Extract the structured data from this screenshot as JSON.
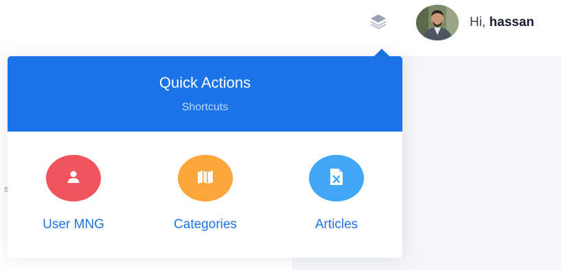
{
  "header": {
    "greeting_prefix": "Hi,",
    "username": "hassan",
    "layers_icon": "layers-icon",
    "avatar_icon": "user-avatar"
  },
  "quick_actions": {
    "title": "Quick Actions",
    "subtitle": "Shortcuts",
    "items": [
      {
        "label": "User MNG",
        "icon": "user-icon",
        "color": "#f0545d"
      },
      {
        "label": "Categories",
        "icon": "map-icon",
        "color": "#fba53b"
      },
      {
        "label": "Articles",
        "icon": "excel-file-icon",
        "color": "#40a6f5"
      }
    ]
  },
  "background_text": "s",
  "colors": {
    "accent": "#1a73e8",
    "content_background": "#f3f5fa",
    "user_color": "#f0545d",
    "categories_color": "#fba53b",
    "articles_color": "#40a6f5"
  }
}
